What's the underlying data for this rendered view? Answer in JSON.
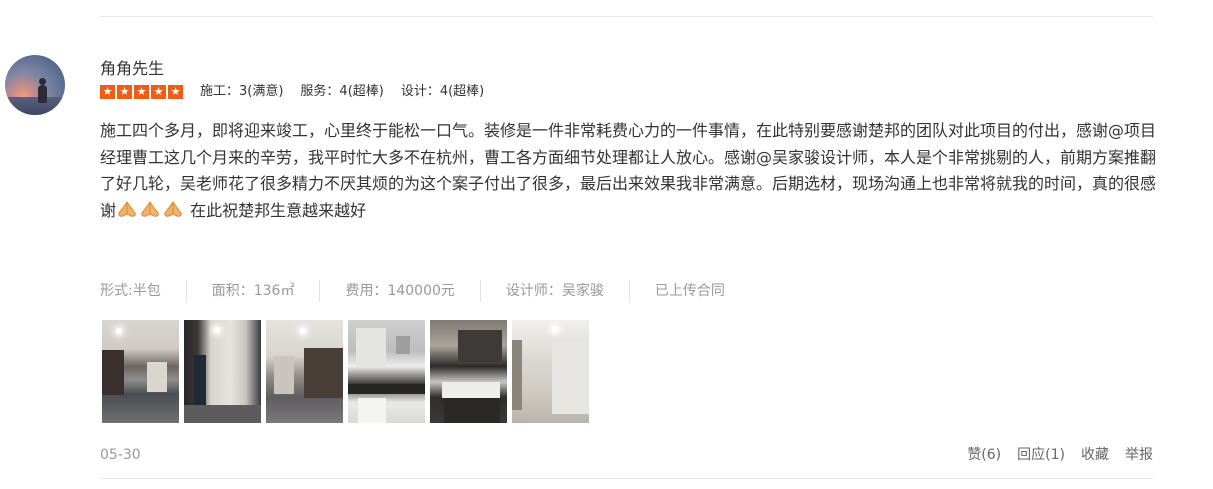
{
  "review": {
    "username": "角角先生",
    "star_count": 5,
    "star_glyph": "★",
    "star_color": "#f25d16",
    "ratings": {
      "construction": "施工：3(满意)",
      "service": "服务：4(超棒)",
      "design": "设计：4(超棒)"
    },
    "content_text": "施工四个多月，即将迎来竣工，心里终于能松一口气。装修是一件非常耗费心力的一件事情，在此特别要感谢楚邦的团队对此项目的付出，感谢@项目经理曹工这几个月来的辛劳，我平时忙大多不在杭州，曹工各方面细节处理都让人放心。感谢@吴家骏设计师，本人是个非常挑剔的人，前期方案推翻了好几轮，吴老师花了很多精力不厌其烦的为这个案子付出了很多，最后出来效果我非常满意。后期选材，现场沟通上也非常将就我的时间，真的很感谢",
    "content_emoji": "praying-hands-icon",
    "content_tail": " 在此祝楚邦生意越来越好",
    "meta": {
      "form": "形式:半包",
      "area": "面积：136㎡",
      "cost": "费用：140000元",
      "designer": "设计师：吴家骏",
      "contract": "已上传合同"
    },
    "photo_count": 6,
    "date": "05-30",
    "actions": {
      "like": "赞(6)",
      "reply": "回应(1)",
      "favorite": "收藏",
      "report": "举报"
    }
  }
}
